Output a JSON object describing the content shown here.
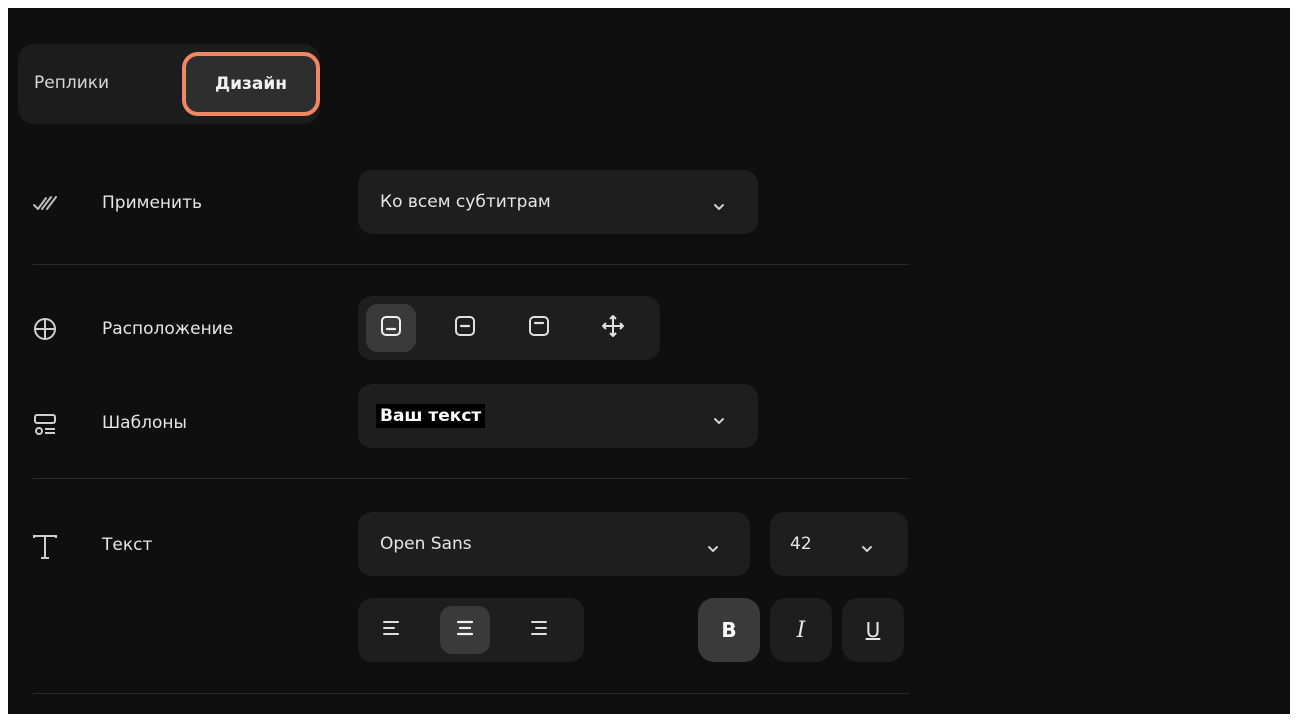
{
  "tabs": {
    "replies": "Реплики",
    "design": "Дизайн"
  },
  "apply": {
    "label": "Применить",
    "value": "Ко всем субтитрам"
  },
  "position": {
    "label": "Расположение",
    "active_index": 0
  },
  "templates": {
    "label": "Шаблоны",
    "value": "Ваш текст"
  },
  "text": {
    "label": "Текст",
    "font": "Open Sans",
    "size": "42",
    "bold_glyph": "B",
    "italic_glyph": "I",
    "underline_glyph": "U"
  },
  "colors": {
    "accent": "#f08763",
    "background": "#0f0f0f",
    "control": "#1e1e1e",
    "active": "#3a3a3a"
  }
}
